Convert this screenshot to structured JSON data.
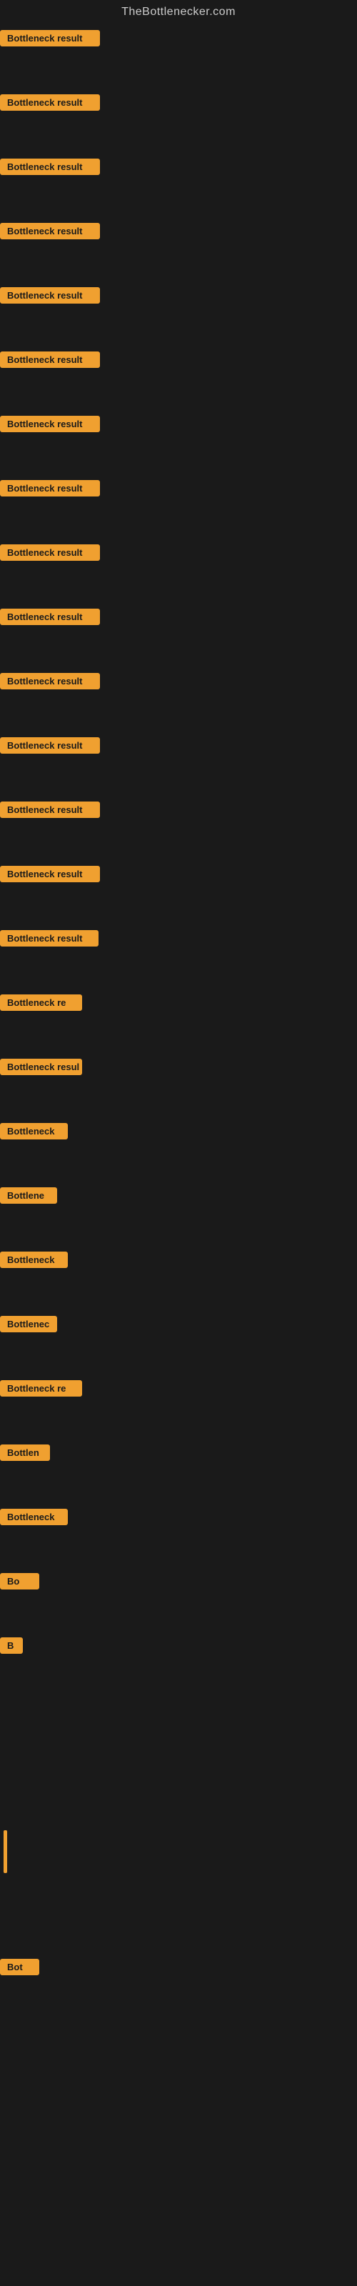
{
  "site": {
    "title": "TheBottlenecker.com"
  },
  "items": [
    {
      "id": 1,
      "label": "Bottleneck result",
      "width_class": "w-full"
    },
    {
      "id": 2,
      "label": "Bottleneck result",
      "width_class": "w-full"
    },
    {
      "id": 3,
      "label": "Bottleneck result",
      "width_class": "w-full"
    },
    {
      "id": 4,
      "label": "Bottleneck result",
      "width_class": "w-full"
    },
    {
      "id": 5,
      "label": "Bottleneck result",
      "width_class": "w-full"
    },
    {
      "id": 6,
      "label": "Bottleneck result",
      "width_class": "w-full"
    },
    {
      "id": 7,
      "label": "Bottleneck result",
      "width_class": "w-full"
    },
    {
      "id": 8,
      "label": "Bottleneck result",
      "width_class": "w-full"
    },
    {
      "id": 9,
      "label": "Bottleneck result",
      "width_class": "w-full"
    },
    {
      "id": 10,
      "label": "Bottleneck result",
      "width_class": "w-full"
    },
    {
      "id": 11,
      "label": "Bottleneck result",
      "width_class": "w-full"
    },
    {
      "id": 12,
      "label": "Bottleneck result",
      "width_class": "w-full"
    },
    {
      "id": 13,
      "label": "Bottleneck result",
      "width_class": "w-full"
    },
    {
      "id": 14,
      "label": "Bottleneck result",
      "width_class": "w-full"
    },
    {
      "id": 15,
      "label": "Bottleneck result",
      "width_class": "w-large"
    },
    {
      "id": 16,
      "label": "Bottleneck re",
      "width_class": "w-medium-large"
    },
    {
      "id": 17,
      "label": "Bottleneck resul",
      "width_class": "w-medium-large"
    },
    {
      "id": 18,
      "label": "Bottleneck",
      "width_class": "w-medium"
    },
    {
      "id": 19,
      "label": "Bottlene",
      "width_class": "w-small-medium"
    },
    {
      "id": 20,
      "label": "Bottleneck",
      "width_class": "w-medium"
    },
    {
      "id": 21,
      "label": "Bottlenec",
      "width_class": "w-small-medium"
    },
    {
      "id": 22,
      "label": "Bottleneck re",
      "width_class": "w-medium-large"
    },
    {
      "id": 23,
      "label": "Bottlen",
      "width_class": "w-small"
    },
    {
      "id": 24,
      "label": "Bottleneck",
      "width_class": "w-medium"
    },
    {
      "id": 25,
      "label": "Bo",
      "width_class": "w-smaller"
    },
    {
      "id": 26,
      "label": "B",
      "width_class": "w-tiny"
    },
    {
      "id": 27,
      "label": "",
      "width_class": "w-zero"
    },
    {
      "id": 28,
      "label": "",
      "width_class": "w-zero"
    },
    {
      "id": 29,
      "label": "|",
      "width_class": "w-nano"
    },
    {
      "id": 30,
      "label": "",
      "width_class": "w-zero"
    },
    {
      "id": 31,
      "label": "Bot",
      "width_class": "w-smaller"
    },
    {
      "id": 32,
      "label": "",
      "width_class": "w-zero"
    },
    {
      "id": 33,
      "label": "",
      "width_class": "w-zero"
    },
    {
      "id": 34,
      "label": "",
      "width_class": "w-zero"
    },
    {
      "id": 35,
      "label": "",
      "width_class": "w-zero"
    }
  ]
}
